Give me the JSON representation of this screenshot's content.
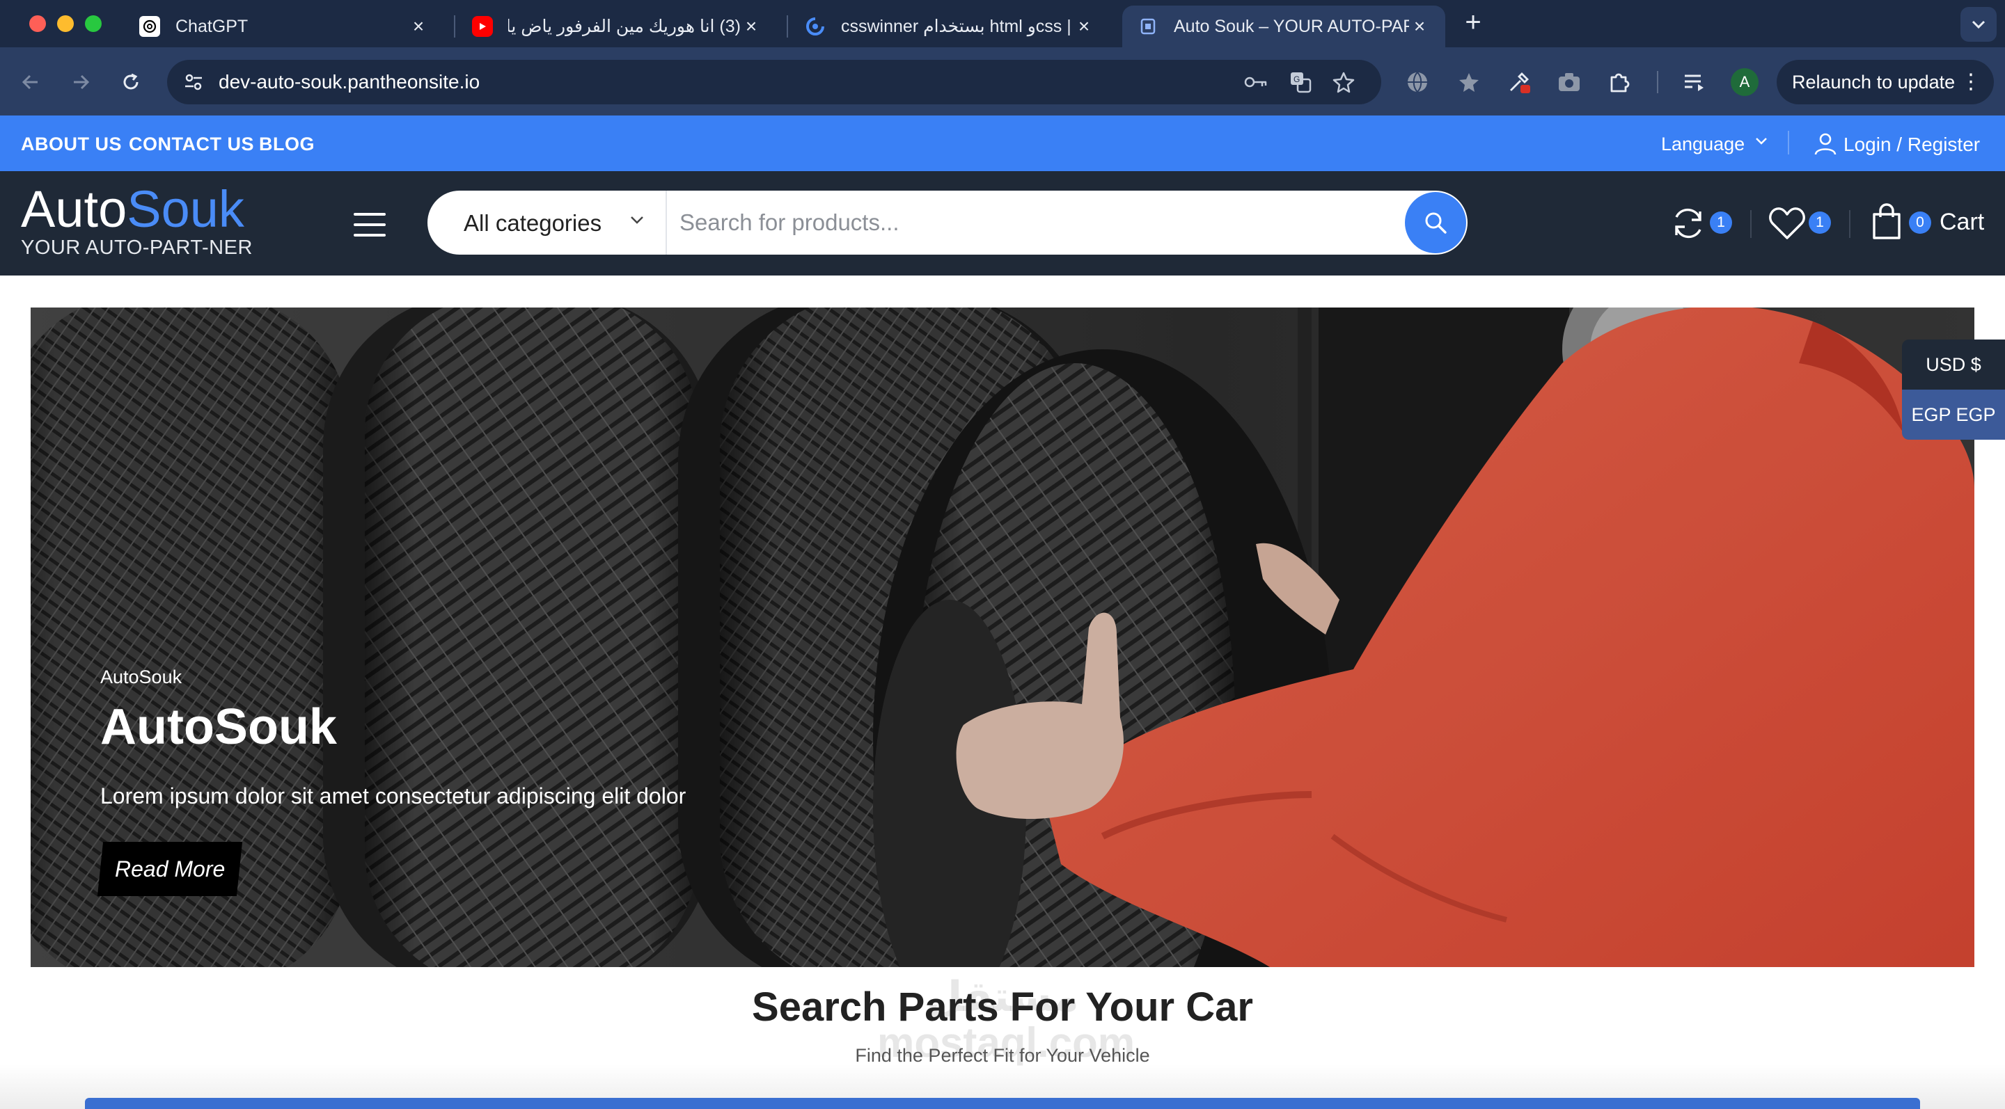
{
  "browser": {
    "tabs": [
      {
        "label": "ChatGPT",
        "icon": "chatgpt-icon"
      },
      {
        "label": "(3) انا هوريك مين الفرفور ياض يا نا",
        "icon": "youtube-icon"
      },
      {
        "label": "csswinner بستخدام html وcss |",
        "icon": "site-icon"
      },
      {
        "label": "Auto Souk – YOUR AUTO-PART-NER",
        "icon": "autosouk-icon",
        "active": true
      }
    ],
    "url": "dev-auto-souk.pantheonsite.io",
    "profile_initial": "A",
    "relaunch_label": "Relaunch to update"
  },
  "topbar": {
    "links": [
      "ABOUT US",
      "CONTACT US",
      "BLOG"
    ],
    "language_label": "Language",
    "login_label": "Login / Register"
  },
  "header": {
    "logo_part1": "Auto",
    "logo_part2": "Souk",
    "tagline": "YOUR AUTO-PART-NER",
    "category_label": "All categories",
    "search_placeholder": "Search for products...",
    "compare_count": "1",
    "wishlist_count": "1",
    "cart_count": "0",
    "cart_label": "Cart"
  },
  "hero": {
    "small_title": "AutoSouk",
    "title": "AutoSouk",
    "description": "Lorem ipsum dolor sit amet consectetur adipiscing elit dolor",
    "button_label": "Read More"
  },
  "currency": {
    "options": [
      "USD $",
      "EGP EGP"
    ]
  },
  "section": {
    "title_bold": "Search Parts For",
    "title_rest": " Your Car",
    "subtitle": "Find the Perfect Fit for Your Vehicle",
    "watermark_line1": "مستقل",
    "watermark_line2": "mostaql.com"
  },
  "colors": {
    "brand_blue": "#3a80f5",
    "header_dark": "#1f2937",
    "chrome_dark": "#1c2a44",
    "chrome_toolbar": "#2b3e63"
  }
}
